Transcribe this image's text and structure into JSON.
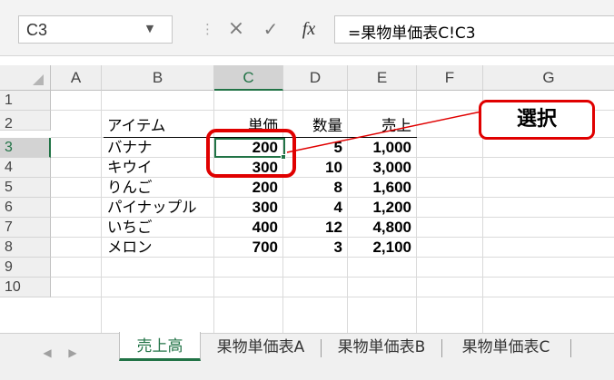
{
  "formula_bar": {
    "name_box": "C3",
    "name_box_dropdown": "▼",
    "separator": "⋮",
    "cancel_icon": "×",
    "enter_icon": "✓",
    "fx_icon": "fx",
    "formula": "=果物単価表C!C3"
  },
  "columns": [
    "A",
    "B",
    "C",
    "D",
    "E",
    "F",
    "G"
  ],
  "selected_column": "C",
  "rows": [
    "1",
    "2",
    "3",
    "4",
    "5",
    "6",
    "7",
    "8",
    "9",
    "10"
  ],
  "selected_row": "3",
  "table": {
    "headers": {
      "item": "アイテム",
      "price": "単価",
      "qty": "数量",
      "sales": "売上"
    },
    "records": [
      {
        "item": "バナナ",
        "price": "200",
        "qty": "5",
        "sales": "1,000"
      },
      {
        "item": "キウイ",
        "price": "300",
        "qty": "10",
        "sales": "3,000"
      },
      {
        "item": "りんご",
        "price": "200",
        "qty": "8",
        "sales": "1,600"
      },
      {
        "item": "パイナップル",
        "price": "300",
        "qty": "4",
        "sales": "1,200"
      },
      {
        "item": "いちご",
        "price": "400",
        "qty": "12",
        "sales": "4,800"
      },
      {
        "item": "メロン",
        "price": "700",
        "qty": "3",
        "sales": "2,100"
      }
    ]
  },
  "annotation": {
    "label": "選択",
    "color": "#e00000"
  },
  "sheet_tabs": {
    "prev_icon": "◀",
    "next_icon": "▶",
    "tabs": [
      "売上高",
      "果物単価表A",
      "果物単価表B",
      "果物単価表C"
    ],
    "active": "売上高"
  },
  "colors": {
    "excel_green": "#217346"
  }
}
